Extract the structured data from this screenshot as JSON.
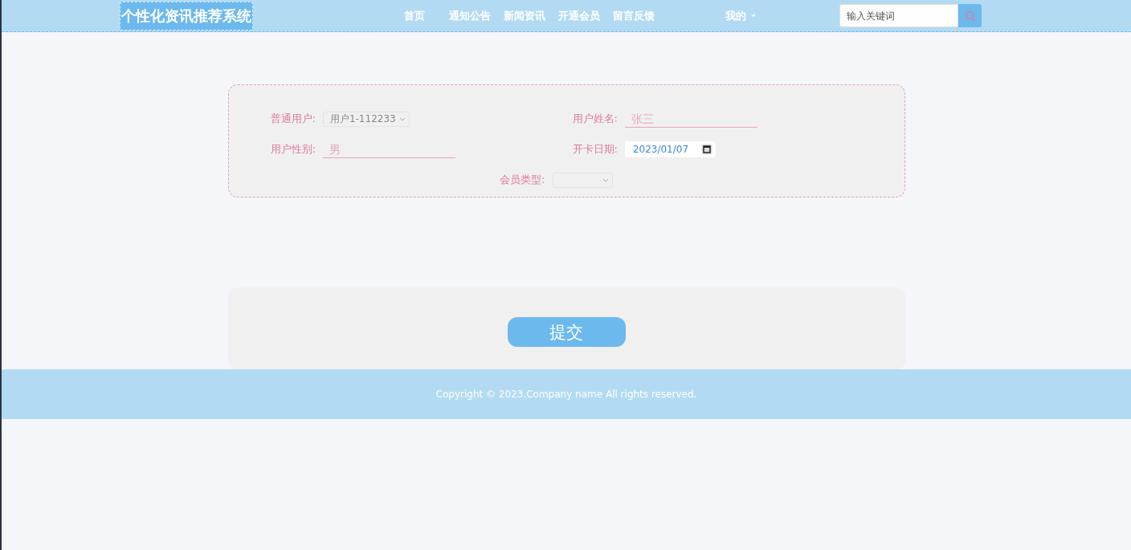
{
  "header": {
    "logo": "个性化资讯推荐系统",
    "nav": [
      {
        "label": "首页",
        "selected": false
      },
      {
        "label": "通知公告",
        "selected": false
      },
      {
        "label": "新闻资讯",
        "selected": false
      },
      {
        "label": "开通会员",
        "selected": false
      },
      {
        "label": "留言反馈",
        "selected": false
      }
    ],
    "account_menu": "我的",
    "search": {
      "placeholder": "输入关键词"
    }
  },
  "form": {
    "fields": [
      {
        "kind": "select",
        "label": "普通用户:",
        "value": "用户1-112233"
      },
      {
        "kind": "text",
        "label": "用户姓名:",
        "placeholder": "张三"
      },
      {
        "kind": "text",
        "label": "用户性别:",
        "placeholder": "男"
      },
      {
        "kind": "date",
        "label": "开卡日期:",
        "value": "2023/01/07"
      },
      {
        "kind": "select",
        "label": "会员类型:"
      }
    ],
    "submit": "提交"
  },
  "footer": {
    "copyright": "Copyright © 2023.Company name All rights reserved."
  }
}
